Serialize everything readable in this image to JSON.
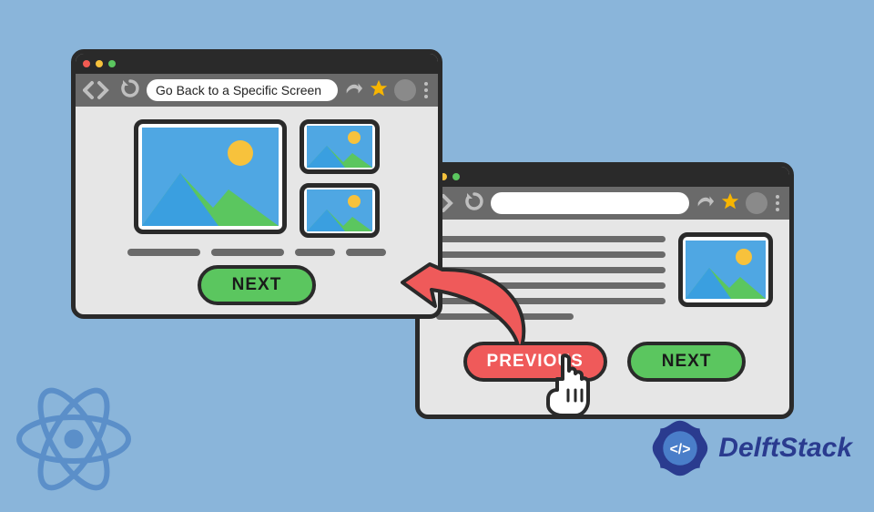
{
  "leftBrowser": {
    "urlText": "Go Back to a Specific Screen",
    "nextLabel": "NEXT"
  },
  "rightBrowser": {
    "urlText": "",
    "prevLabel": "PREVIOUS",
    "nextLabel": "NEXT"
  },
  "brand": {
    "name": "DelftStack"
  },
  "colors": {
    "bg": "#8ab5da",
    "green": "#5bc65f",
    "red": "#ef5a5a",
    "dark": "#2a2a2a"
  }
}
